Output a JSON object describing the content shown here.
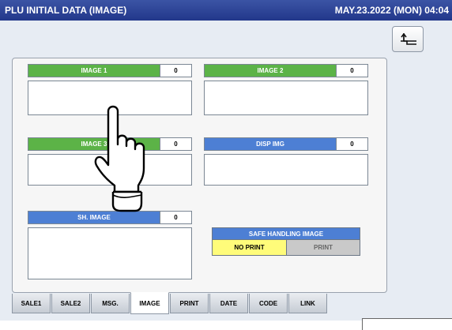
{
  "header": {
    "title": "PLU INITIAL DATA (IMAGE)",
    "datetime": "MAY.23.2022 (MON)  04:04"
  },
  "fields": [
    {
      "label": "IMAGE 1",
      "value": "0",
      "color": "#5cb347"
    },
    {
      "label": "IMAGE 2",
      "value": "0",
      "color": "#5cb347"
    },
    {
      "label": "IMAGE 3",
      "value": "0",
      "color": "#5cb347"
    },
    {
      "label": "DISP IMG",
      "value": "0",
      "color": "#4d7fd4"
    },
    {
      "label": "SH. IMAGE",
      "value": "0",
      "color": "#4d7fd4"
    }
  ],
  "safe_handling": {
    "title": "SAFE HANDLING IMAGE",
    "options": [
      "NO PRINT",
      "PRINT"
    ],
    "selected": "NO PRINT"
  },
  "tabs": [
    "SALE1",
    "SALE2",
    "MSG.",
    "IMAGE",
    "PRINT",
    "DATE",
    "CODE",
    "LINK"
  ],
  "active_tab": "IMAGE",
  "icons": {
    "back": "return-arrow-icon",
    "pointer": "pointing-hand-icon"
  }
}
